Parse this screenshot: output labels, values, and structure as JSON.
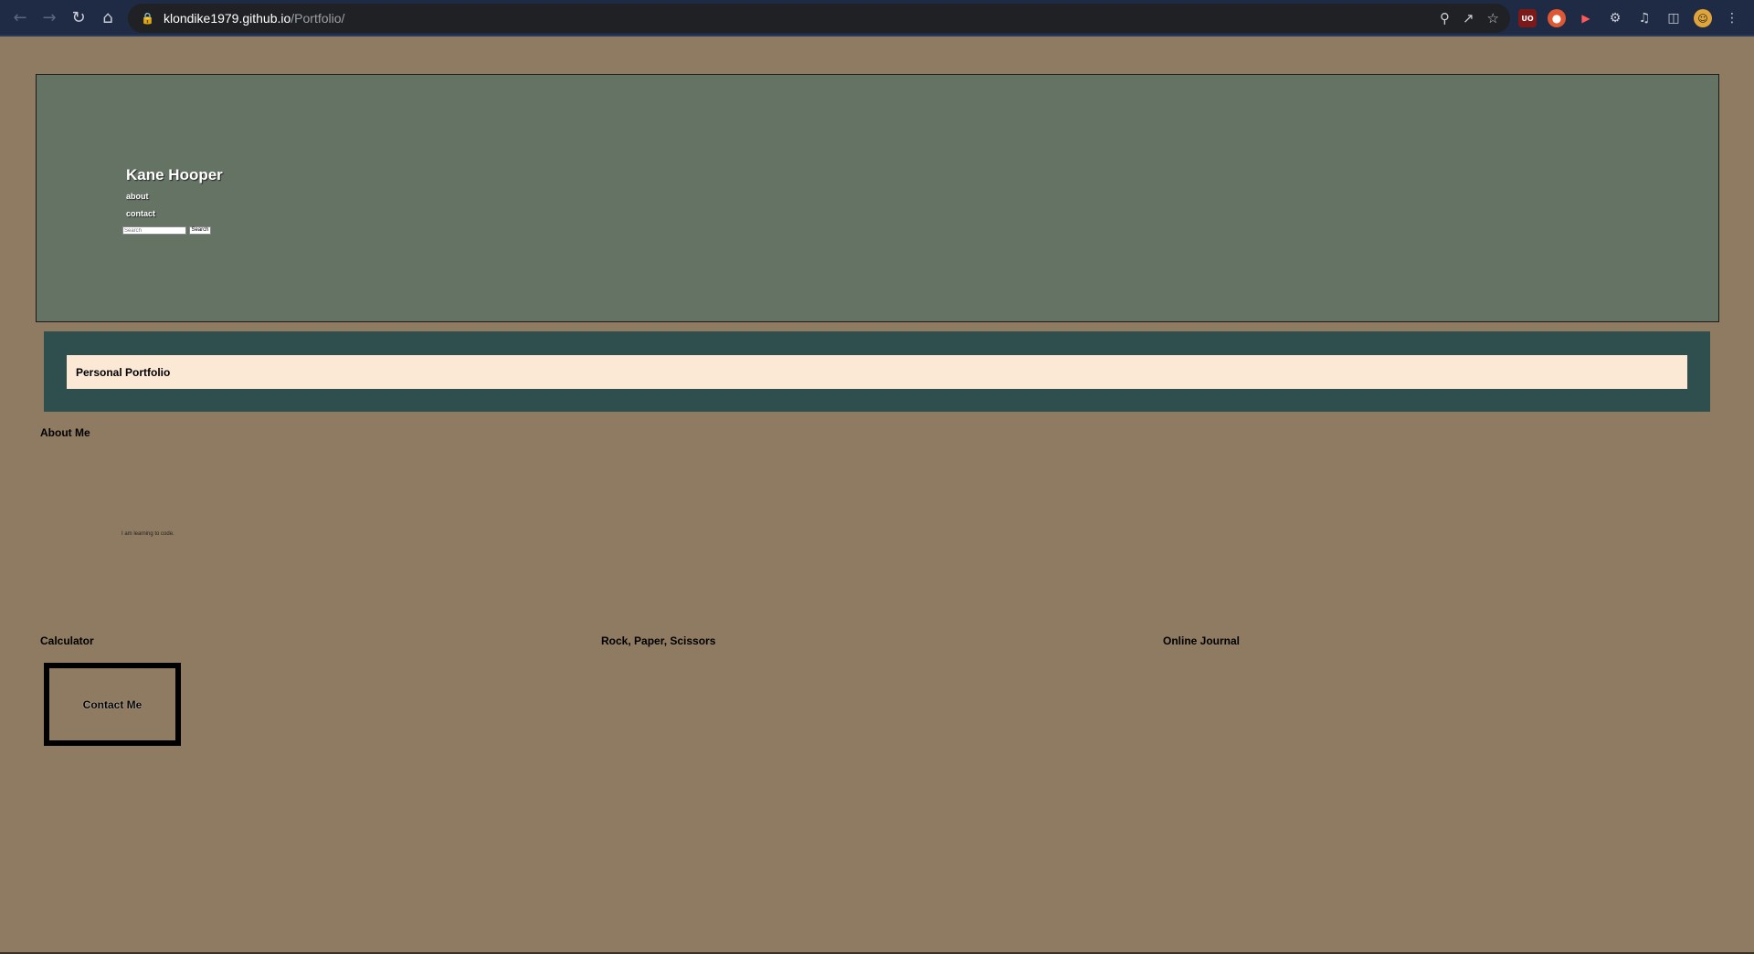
{
  "browser": {
    "url_host": "klondike1979.github.io",
    "url_path": "/Portfolio/",
    "icons": {
      "back": "arrow-left-icon",
      "forward": "arrow-right-icon",
      "reload": "reload-icon",
      "home": "home-icon",
      "lock": "lock-icon",
      "zoom": "zoom-icon",
      "share": "share-icon",
      "bookmark": "star-icon",
      "extensions": "puzzle-icon",
      "media": "media-queue-icon",
      "sidepanel": "side-panel-icon",
      "profile": "profile-avatar-icon",
      "menu": "kebab-menu-icon"
    },
    "extension_badges": {
      "ublock": "UO"
    }
  },
  "header": {
    "title": "Kane Hooper",
    "nav": [
      "about",
      "contact"
    ],
    "search_placeholder": "Search",
    "search_button": "Search"
  },
  "banner": {
    "label": "Personal Portfolio"
  },
  "about": {
    "title": "About Me",
    "text": "I am learning to code."
  },
  "projects": {
    "calculator": "Calculator",
    "rps": "Rock, Paper, Scissors",
    "journal": "Online Journal"
  },
  "contact": {
    "label": "Contact Me"
  },
  "colors": {
    "page_bg": "#8f7b61",
    "header_bg": "#647363",
    "banner_bg": "#2f4f4f",
    "banner_inner": "#fbe9d5",
    "chrome_bg": "#1f2a44"
  }
}
